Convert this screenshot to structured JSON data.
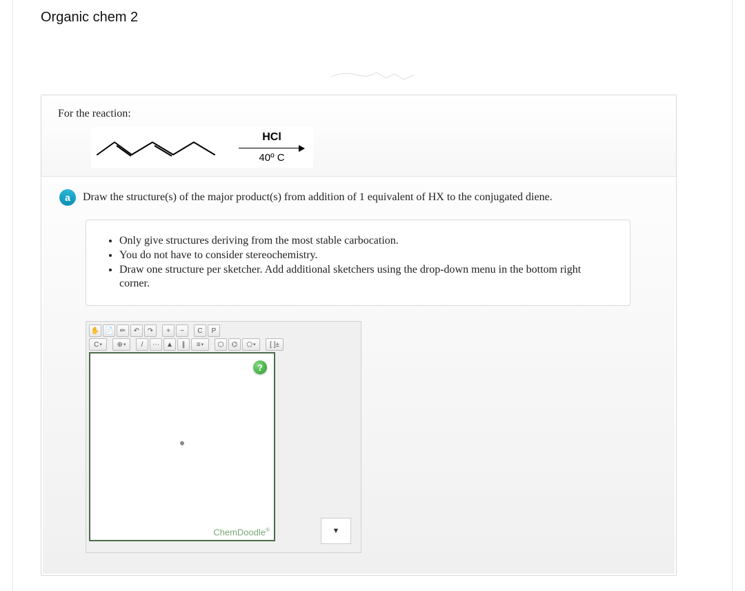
{
  "page": {
    "title": "Organic chem 2"
  },
  "question": {
    "prompt_label": "For the reaction:",
    "reagent_top": "HCl",
    "reagent_bottom": "40º C",
    "part_letter": "a",
    "part_text": "Draw the structure(s) of the major product(s) from addition of 1 equivalent of HX to the conjugated diene.",
    "hints": [
      "Only give structures deriving from the most stable carbocation.",
      "You do not have to consider stereochemistry.",
      "Draw one structure per sketcher. Add additional sketchers using the drop-down menu in the bottom right corner."
    ]
  },
  "sketcher": {
    "toolbar1": {
      "hand": "✋",
      "open": "📄",
      "erase": "✏",
      "undo": "↶",
      "redo": "↷",
      "zoom_in": "+",
      "zoom_out": "−",
      "copy_c": "C",
      "paste_p": "P"
    },
    "toolbar2": {
      "atom_c": "C",
      "charge": "⊕",
      "bond_single": "/",
      "bond_dotted": "⋯",
      "bond_wedge": "▲",
      "bond_double": "∥",
      "bond_triple": "≡",
      "ring_hex": "⬡",
      "ring_benz": "⌬",
      "ring_pent": "⬠",
      "brackets": "[ ]±"
    },
    "help_label": "?",
    "brand": "ChemDoodle",
    "dropdown_glyph": "▼"
  }
}
